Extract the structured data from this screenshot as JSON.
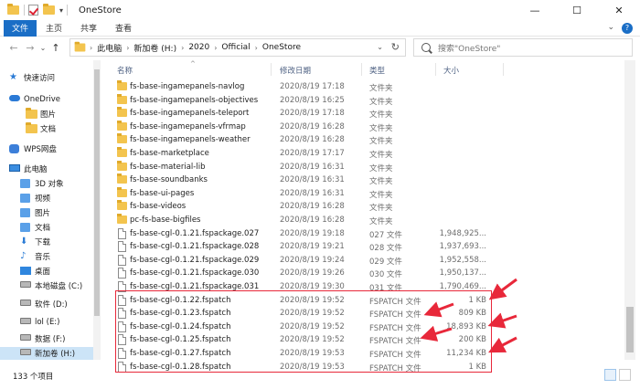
{
  "window": {
    "title": "OneStore",
    "dropdown_glyph": "▾",
    "minimize": "—",
    "maximize": "☐",
    "close": "✕"
  },
  "ribbon": {
    "tabs": [
      "文件",
      "主页",
      "共享",
      "查看"
    ],
    "expand": "⌄",
    "help": "?"
  },
  "nav": {
    "back": "←",
    "forward": "→",
    "recent": "⌄",
    "up": "↑"
  },
  "address": {
    "crumbs": [
      "此电脑",
      "新加卷 (H:)",
      "2020",
      "Official",
      "OneStore"
    ],
    "sep": "›",
    "dropdown": "⌄",
    "refresh": "↻"
  },
  "search": {
    "placeholder": "搜索\"OneStore\""
  },
  "columns": {
    "name": "名称",
    "date": "修改日期",
    "type": "类型",
    "size": "大小",
    "sort_glyph": "^"
  },
  "navpane": {
    "items": [
      {
        "label": "快速访问",
        "icon": "star-icon"
      },
      {
        "label": "OneDrive",
        "icon": "cloud-icon"
      },
      {
        "label": "图片",
        "icon": "folder-icon"
      },
      {
        "label": "文档",
        "icon": "folder-icon"
      },
      {
        "label": "WPS网盘",
        "icon": "wps-icon"
      },
      {
        "label": "此电脑",
        "icon": "pc-icon"
      },
      {
        "label": "3D 对象",
        "icon": "3d-objects-icon"
      },
      {
        "label": "视频",
        "icon": "video-icon"
      },
      {
        "label": "图片",
        "icon": "pictures-icon"
      },
      {
        "label": "文档",
        "icon": "documents-icon"
      },
      {
        "label": "下载",
        "icon": "download-icon"
      },
      {
        "label": "音乐",
        "icon": "music-icon"
      },
      {
        "label": "桌面",
        "icon": "desktop-icon"
      },
      {
        "label": "本地磁盘 (C:)",
        "icon": "drive-icon"
      },
      {
        "label": "软件 (D:)",
        "icon": "drive-icon"
      },
      {
        "label": "lol (E:)",
        "icon": "drive-icon"
      },
      {
        "label": "数据 (F:)",
        "icon": "drive-icon"
      },
      {
        "label": "新加卷 (H:)",
        "icon": "drive-icon",
        "selected": true
      }
    ]
  },
  "files": [
    {
      "name": "fs-base-ingamepanels-navlog",
      "date": "2020/8/19 17:18",
      "type": "文件夹",
      "size": "",
      "kind": "folder"
    },
    {
      "name": "fs-base-ingamepanels-objectives",
      "date": "2020/8/19 16:25",
      "type": "文件夹",
      "size": "",
      "kind": "folder"
    },
    {
      "name": "fs-base-ingamepanels-teleport",
      "date": "2020/8/19 17:18",
      "type": "文件夹",
      "size": "",
      "kind": "folder"
    },
    {
      "name": "fs-base-ingamepanels-vfrmap",
      "date": "2020/8/19 16:28",
      "type": "文件夹",
      "size": "",
      "kind": "folder"
    },
    {
      "name": "fs-base-ingamepanels-weather",
      "date": "2020/8/19 16:28",
      "type": "文件夹",
      "size": "",
      "kind": "folder"
    },
    {
      "name": "fs-base-marketplace",
      "date": "2020/8/19 17:17",
      "type": "文件夹",
      "size": "",
      "kind": "folder"
    },
    {
      "name": "fs-base-material-lib",
      "date": "2020/8/19 16:31",
      "type": "文件夹",
      "size": "",
      "kind": "folder"
    },
    {
      "name": "fs-base-soundbanks",
      "date": "2020/8/19 16:31",
      "type": "文件夹",
      "size": "",
      "kind": "folder"
    },
    {
      "name": "fs-base-ui-pages",
      "date": "2020/8/19 16:31",
      "type": "文件夹",
      "size": "",
      "kind": "folder"
    },
    {
      "name": "fs-base-videos",
      "date": "2020/8/19 16:28",
      "type": "文件夹",
      "size": "",
      "kind": "folder"
    },
    {
      "name": "pc-fs-base-bigfiles",
      "date": "2020/8/19 16:28",
      "type": "文件夹",
      "size": "",
      "kind": "folder"
    },
    {
      "name": "fs-base-cgl-0.1.21.fspackage.027",
      "date": "2020/8/19 19:18",
      "type": "027 文件",
      "size": "1,948,925...",
      "kind": "file"
    },
    {
      "name": "fs-base-cgl-0.1.21.fspackage.028",
      "date": "2020/8/19 19:21",
      "type": "028 文件",
      "size": "1,937,693...",
      "kind": "file"
    },
    {
      "name": "fs-base-cgl-0.1.21.fspackage.029",
      "date": "2020/8/19 19:24",
      "type": "029 文件",
      "size": "1,952,558...",
      "kind": "file"
    },
    {
      "name": "fs-base-cgl-0.1.21.fspackage.030",
      "date": "2020/8/19 19:26",
      "type": "030 文件",
      "size": "1,950,137...",
      "kind": "file"
    },
    {
      "name": "fs-base-cgl-0.1.21.fspackage.031",
      "date": "2020/8/19 19:30",
      "type": "031 文件",
      "size": "1,790,469...",
      "kind": "file"
    },
    {
      "name": "fs-base-cgl-0.1.22.fspatch",
      "date": "2020/8/19 19:52",
      "type": "FSPATCH 文件",
      "size": "1 KB",
      "kind": "file"
    },
    {
      "name": "fs-base-cgl-0.1.23.fspatch",
      "date": "2020/8/19 19:52",
      "type": "FSPATCH 文件",
      "size": "809 KB",
      "kind": "file"
    },
    {
      "name": "fs-base-cgl-0.1.24.fspatch",
      "date": "2020/8/19 19:52",
      "type": "FSPATCH 文件",
      "size": "18,893 KB",
      "kind": "file"
    },
    {
      "name": "fs-base-cgl-0.1.25.fspatch",
      "date": "2020/8/19 19:52",
      "type": "FSPATCH 文件",
      "size": "200 KB",
      "kind": "file"
    },
    {
      "name": "fs-base-cgl-0.1.27.fspatch",
      "date": "2020/8/19 19:53",
      "type": "FSPATCH 文件",
      "size": "11,234 KB",
      "kind": "file"
    },
    {
      "name": "fs-base-cgl-0.1.28.fspatch",
      "date": "2020/8/19 19:53",
      "type": "FSPATCH 文件",
      "size": "1 KB",
      "kind": "file"
    }
  ],
  "status": {
    "count": "133 个项目"
  },
  "annotation_color": "#e8283a"
}
